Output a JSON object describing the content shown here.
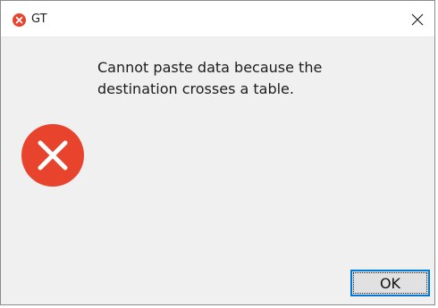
{
  "window": {
    "title": "GT",
    "app_icon": "error-icon-small",
    "close_icon": "close-icon"
  },
  "dialog": {
    "message": "Cannot paste data because the\ndestination crosses a table.",
    "icon": "error-icon",
    "ok_label": "OK"
  },
  "colors": {
    "error_red": "#e8442d",
    "focus_blue": "#0078d7",
    "dialog_bg": "#f0f0f0"
  }
}
